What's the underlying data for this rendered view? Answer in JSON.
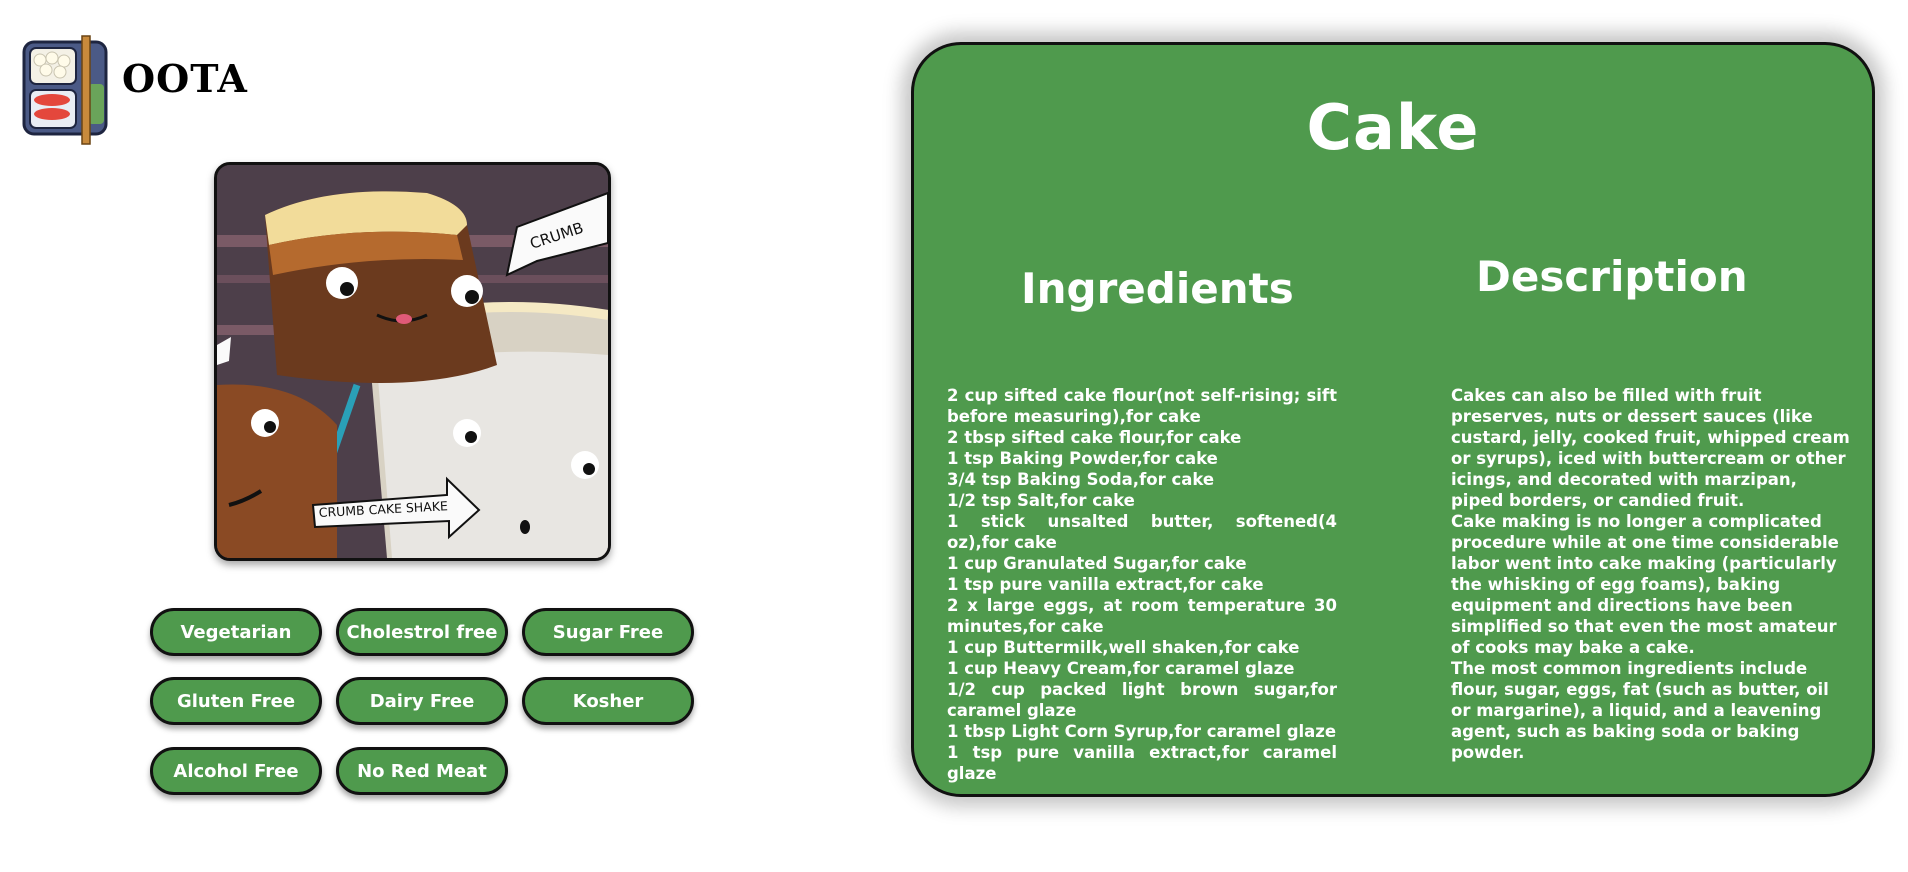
{
  "brand": {
    "name": "OOTA",
    "logo_icon": "bento-box-icon"
  },
  "photo": {
    "alt": "Crumb cake with milkshake",
    "annotations": [
      "CRUMB",
      "CRUMB CAKE SHAKE"
    ]
  },
  "diet_tags": [
    "Vegetarian",
    "Cholestrol free",
    "Sugar Free",
    "Gluten Free",
    "Dairy Free",
    "Kosher",
    "Alcohol Free",
    "No Red Meat"
  ],
  "recipe": {
    "title": "Cake",
    "ingredients_heading": "Ingredients",
    "description_heading": "Description",
    "ingredients": [
      "2 cup sifted cake flour(not self-rising; sift before measuring),for cake",
      "2 tbsp sifted cake flour,for cake",
      "1 tsp Baking Powder,for cake",
      "3/4 tsp Baking Soda,for cake",
      "1/2 tsp Salt,for cake",
      "1 stick unsalted butter, softened(4 oz),for cake",
      "1 cup Granulated Sugar,for cake",
      "1 tsp pure vanilla extract,for cake",
      "2 x large eggs, at room temperature 30 minutes,for cake",
      "1 cup Buttermilk,well shaken,for cake",
      "1 cup Heavy Cream,for caramel glaze",
      "1/2 cup packed light brown sugar,for caramel glaze",
      "1 tbsp Light Corn Syrup,for caramel glaze",
      "1 tsp pure vanilla extract,for caramel glaze"
    ],
    "description": [
      "Cakes can also be filled with fruit preserves, nuts or dessert sauces (like custard, jelly, cooked fruit, whipped cream or syrups), iced with buttercream or other icings, and decorated with marzipan, piped borders, or candied fruit.",
      "Cake making is no longer a complicated procedure while at one time considerable labor went into cake making (particularly the whisking of egg foams), baking equipment and directions have been simplified so that even the most amateur of cooks may bake a cake.",
      "The most common ingredients include flour, sugar, eggs, fat (such as butter, oil or margarine), a liquid, and a leavening agent, such as baking soda or baking powder."
    ]
  },
  "colors": {
    "accent_green": "#4f9a4d",
    "border": "#111111",
    "text_on_green": "#ffffff"
  }
}
